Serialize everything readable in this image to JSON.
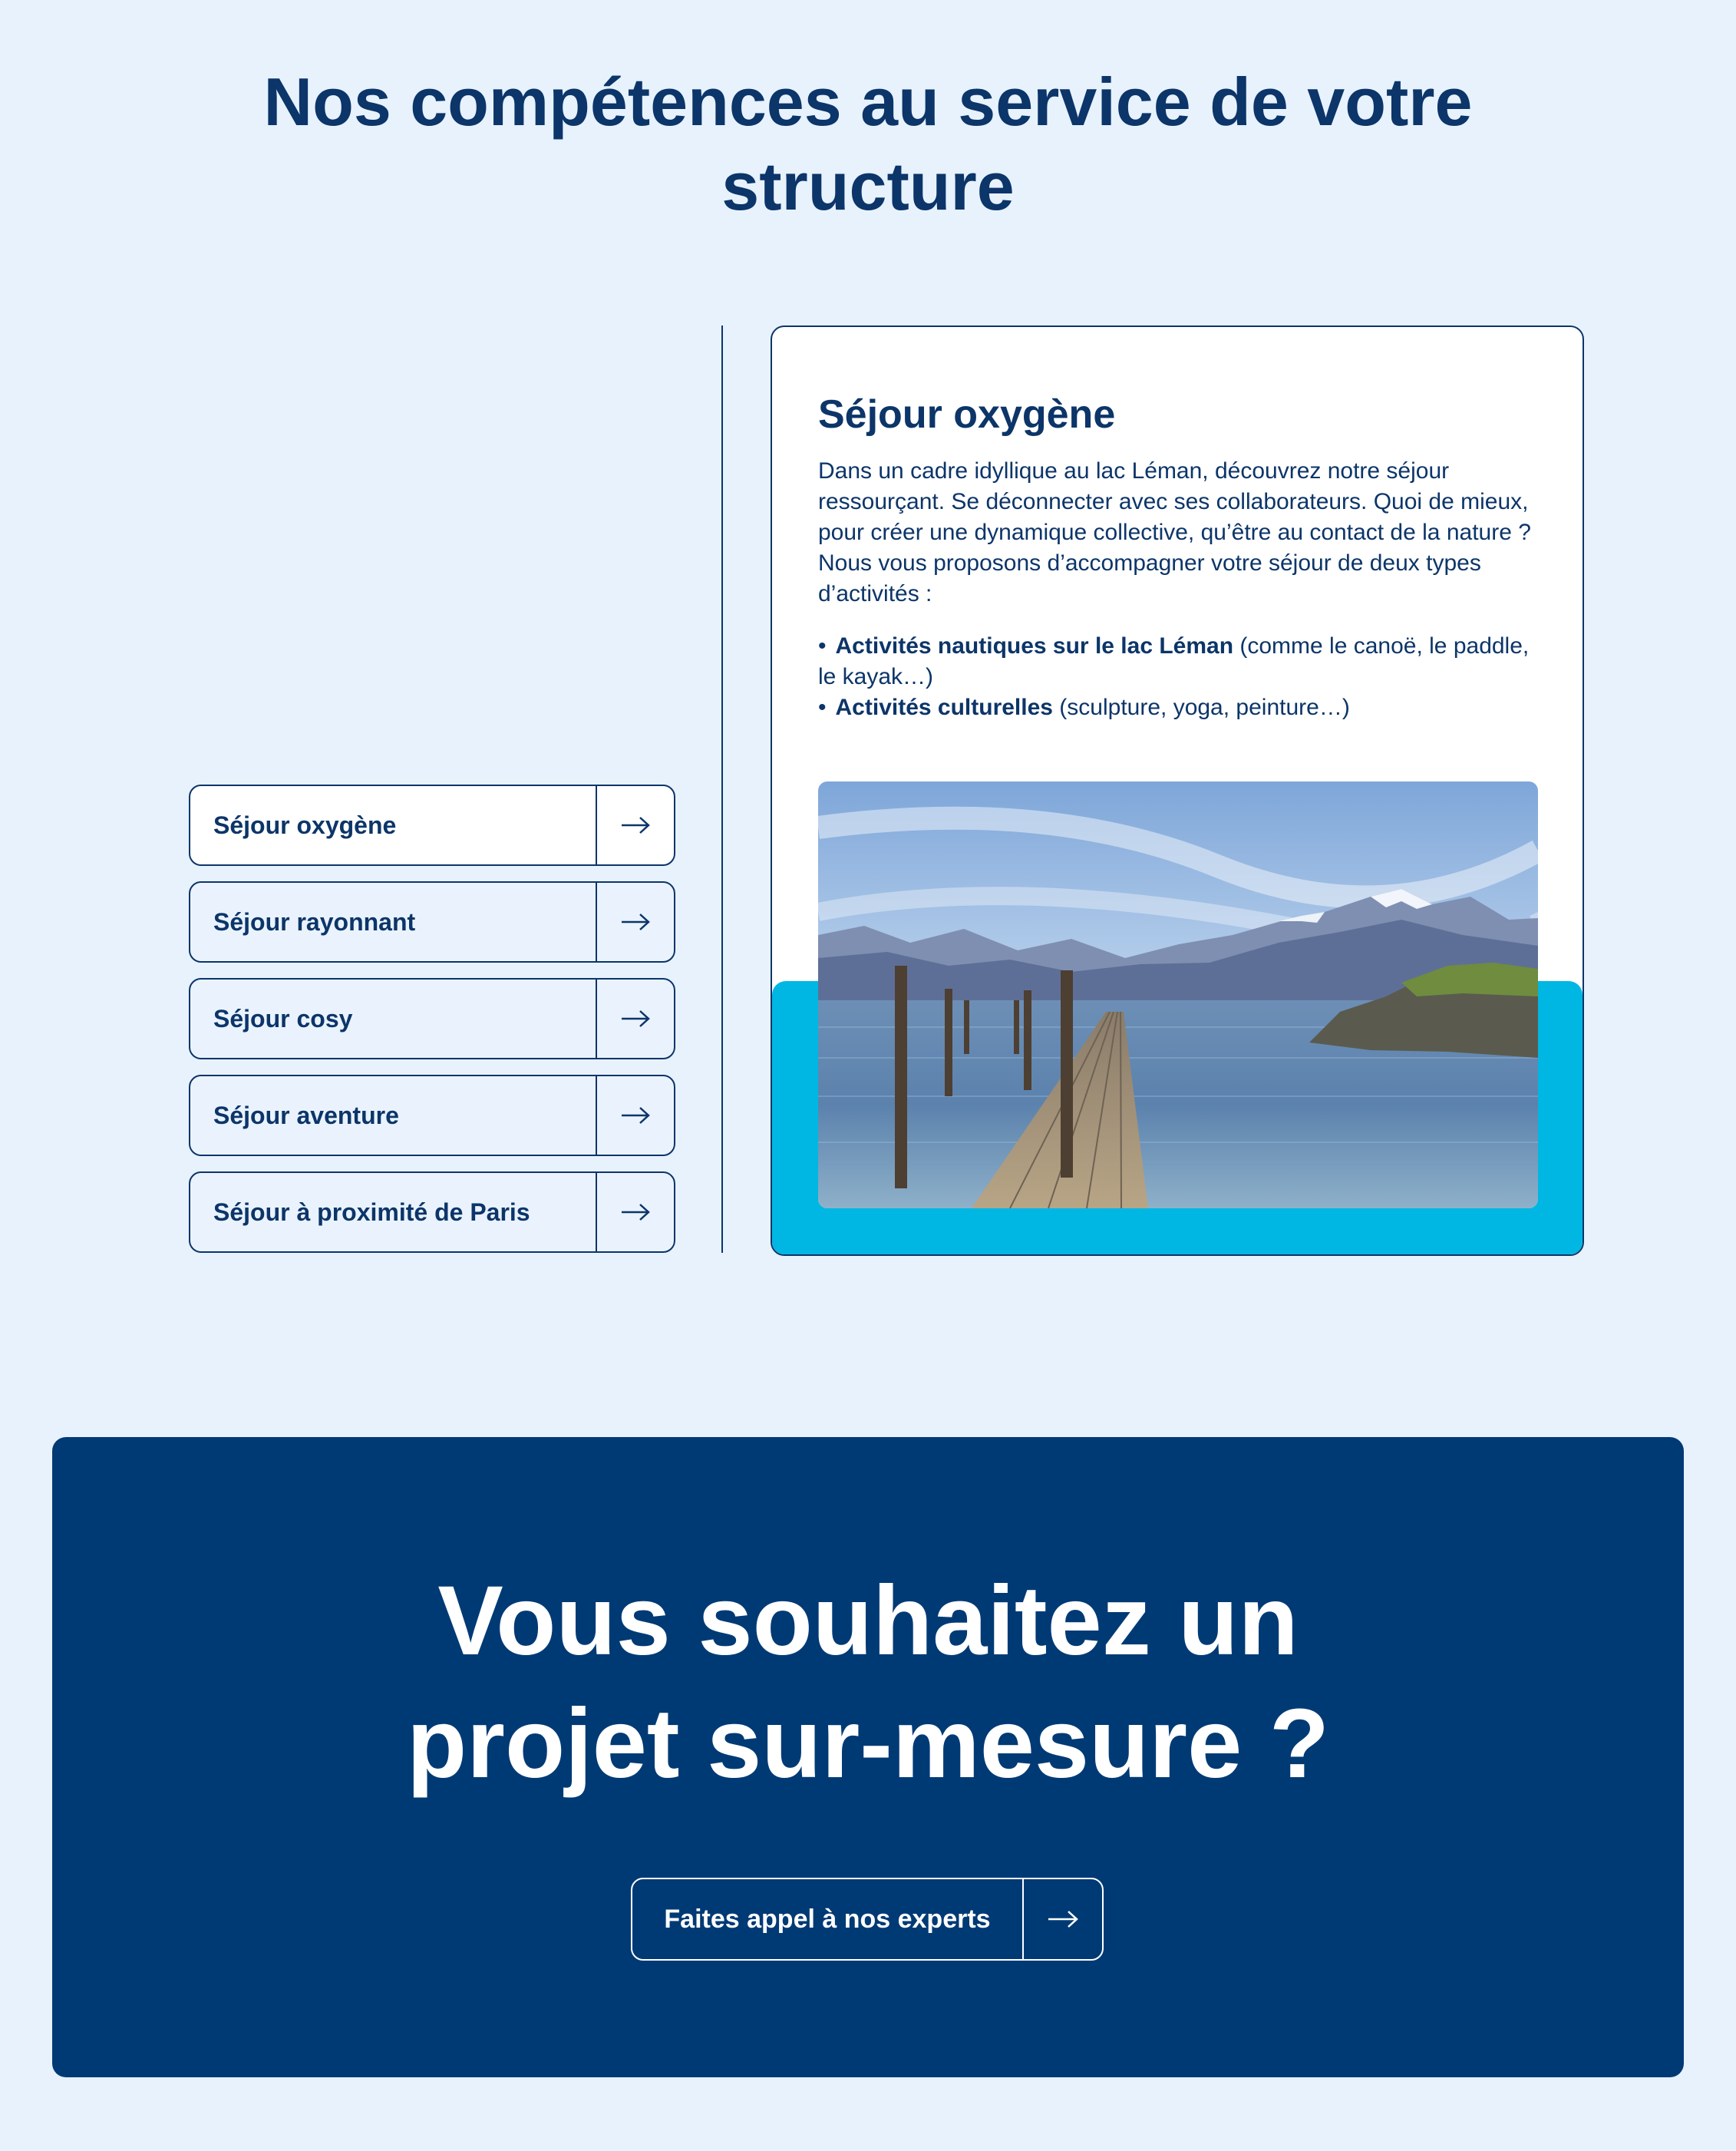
{
  "section": {
    "title_line1": "Nos compétences au service de votre",
    "title_line2": "structure"
  },
  "sejours": {
    "items": [
      {
        "label": "Séjour oxygène",
        "active": true
      },
      {
        "label": "Séjour rayonnant",
        "active": false
      },
      {
        "label": "Séjour cosy",
        "active": false
      },
      {
        "label": "Séjour aventure",
        "active": false
      },
      {
        "label": "Séjour à proximité de Paris",
        "active": false
      }
    ],
    "arrow_icon": "arrow-right-icon"
  },
  "card": {
    "title": "Séjour oxygène",
    "text": "Dans un cadre idyllique au lac Léman, découvrez notre séjour ressourçant. Se déconnecter avec ses collaborateurs. Quoi de mieux, pour créer une dynamique collective, qu’être au contact de la nature ? Nous vous proposons d’accompagner votre séjour de deux types d’activités :",
    "activities": [
      {
        "bold": "Activités nautiques sur le lac Léman",
        "rest": " (comme le canoë, le paddle, le kayak…)"
      },
      {
        "bold": "Activités culturelles",
        "rest": " (sculpture, yoga, peinture…)"
      }
    ],
    "bullet": "•",
    "accent_color": "#00b7e3"
  },
  "cta": {
    "title_line1": "Vous souhaitez un",
    "title_line2": "projet sur-mesure ?",
    "button_label": "Faites appel à nos experts",
    "background_color": "#003a75"
  },
  "colors": {
    "page_background": "#e7f2fd",
    "primary_navy": "#0c3569"
  }
}
